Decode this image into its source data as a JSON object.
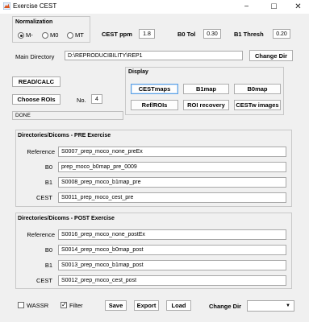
{
  "window": {
    "title": "Exercise CEST",
    "controls": {
      "minimize": "−",
      "maximize": "☐",
      "close": "✕"
    }
  },
  "normalization": {
    "title": "Normalization",
    "options": [
      "M-",
      "M0",
      "MT"
    ],
    "selected": "M-"
  },
  "params": {
    "cest_ppm_label": "CEST ppm",
    "cest_ppm_value": "1.8",
    "b0_tol_label": "B0 Tol",
    "b0_tol_value": "0.30",
    "b1_thresh_label": "B1 Thresh",
    "b1_thresh_value": "0.20"
  },
  "main_dir": {
    "label": "Main Directory",
    "value": "D:\\REPRODUCIBILITY\\REP1",
    "button": "Change Dir"
  },
  "actions": {
    "read_calc": "READ/CALC",
    "choose_rois": "Choose ROIs",
    "no_label": "No.",
    "no_value": "4",
    "status": "DONE"
  },
  "display": {
    "title": "Display",
    "buttons": [
      "CESTmaps",
      "B1map",
      "B0map",
      "Ref/ROIs",
      "ROI recovery",
      "CESTw images"
    ]
  },
  "pre": {
    "title": "Directories/Dicoms - PRE Exercise",
    "rows": [
      {
        "label": "Reference",
        "value": "S0007_prep_moco_none_preEx"
      },
      {
        "label": "B0",
        "value": "prep_moco_b0map_pre_0009"
      },
      {
        "label": "B1",
        "value": "S0008_prep_moco_b1map_pre"
      },
      {
        "label": "CEST",
        "value": "S0011_prep_moco_cest_pre"
      }
    ]
  },
  "post": {
    "title": "Directories/Dicoms - POST Exercise",
    "rows": [
      {
        "label": "Reference",
        "value": "S0016_prep_moco_none_postEx"
      },
      {
        "label": "B0",
        "value": "S0014_prep_moco_b0map_post"
      },
      {
        "label": "B1",
        "value": "S0013_prep_moco_b1map_post"
      },
      {
        "label": "CEST",
        "value": "S0012_prep_moco_cest_post"
      }
    ]
  },
  "footer": {
    "wassr_label": "WASSR",
    "wassr_checked": false,
    "filter_label": "Filter",
    "filter_checked": true,
    "save": "Save",
    "export": "Export",
    "load": "Load",
    "change_dir_label": "Change Dir",
    "dropdown_value": "",
    "dropdown_arrow": "▼"
  }
}
